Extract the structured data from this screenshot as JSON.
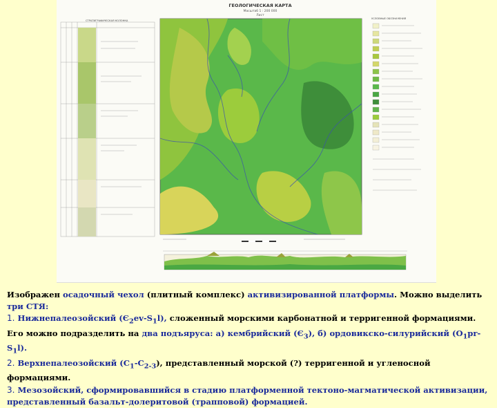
{
  "sheet": {
    "title": "ГЕОЛОГИЧЕСКАЯ КАРТА",
    "subtitle": "Масштаб 1 : 200 000",
    "sheet_no": "Лист",
    "strat_column_title": "СТРАТИГРАФИЧЕСКАЯ КОЛОНКА",
    "legend_title": "УСЛОВНЫЕ ОБОЗНАЧЕНИЯ"
  },
  "colors": {
    "slide_bg": "#ffffcc",
    "map_green": "#5ab84a",
    "map_olive": "#9cc63a",
    "map_yellow": "#d8d45a",
    "map_dark": "#3e8e3a",
    "rivers": "#3a4fb0",
    "caption_highlight": "#1a2a9a"
  },
  "caption": {
    "l1_a": "Изображен ",
    "l1_b": "осадочный чехол",
    "l1_c": " (плитный комплекс) ",
    "l1_d": "активизированной платформы",
    "l1_e": ". Можно выделить ",
    "l1_f": "три СТЯ:",
    "i1_num": "1.",
    "i1_a": " Нижнепалеозойский (Є",
    "i1_b": "2",
    "i1_c": "ev-S",
    "i1_d": "1",
    "i1_e": "l), ",
    "i1_f": "сложенный морскими карбонатной и терригенной формациями. Его можно подразделить на ",
    "i1_g": "два подъяруса",
    "i1_h": ": а) кембрийский (Є",
    "i1_i": "3",
    "i1_j": "), б) ордовикско-силурийский (O",
    "i1_k": "1",
    "i1_l": "pr-S",
    "i1_m": "1",
    "i1_n": "l).",
    "i2_num": "2.",
    "i2_a": " Верхнепалеозойский (C",
    "i2_b": "1",
    "i2_c": "-C",
    "i2_d": "2-3",
    "i2_e": "), представленный морской (?) терригенной и угленосной формациями.",
    "i3_num": "3.",
    "i3_a": " Мезозойский, сформировавшийся в стадию платформенной тектоно-магматической активизации, представленный базальт-долеритовой (трапповой) формацией."
  }
}
